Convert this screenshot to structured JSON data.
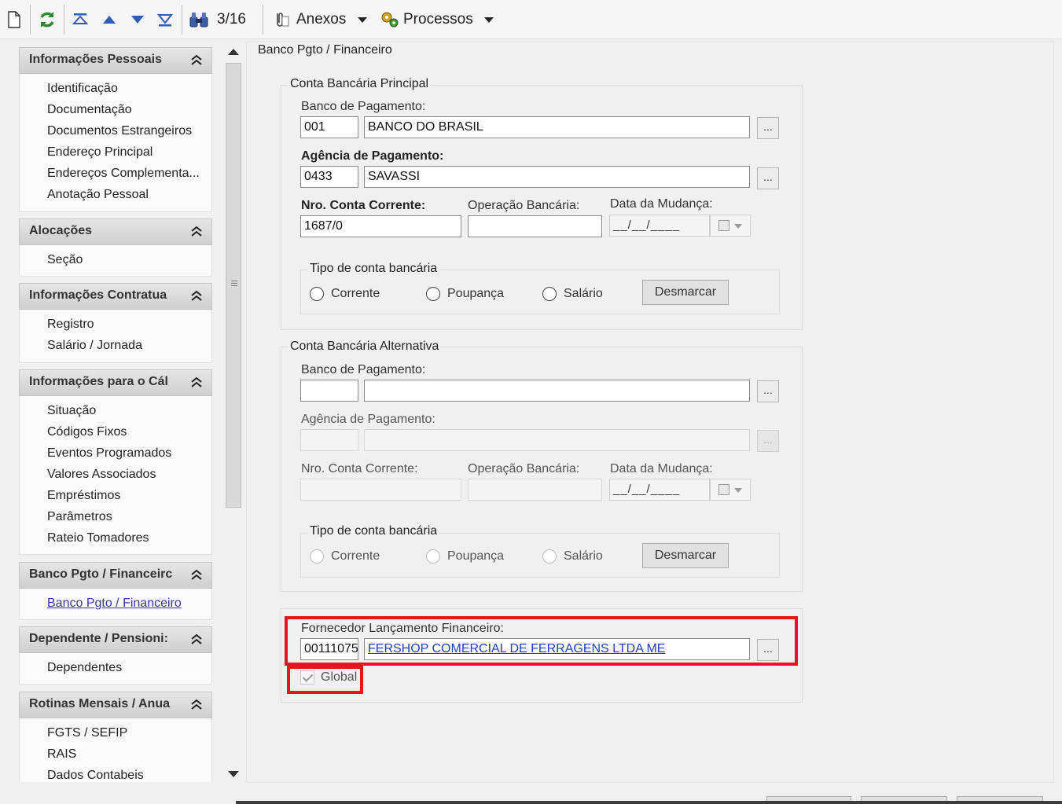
{
  "toolbar": {
    "record_counter": "3/16",
    "attachments_label": "Anexos",
    "processes_label": "Processos",
    "icons": [
      "new-document-icon",
      "refresh-icon",
      "first-record-icon",
      "previous-record-icon",
      "next-record-icon",
      "last-record-icon",
      "binoculars-search-icon",
      "paperclip-icon",
      "gears-icon"
    ]
  },
  "sidebar": {
    "sections": [
      {
        "title": "Informações Pessoais",
        "items": [
          "Identificação",
          "Documentação",
          "Documentos Estrangeiros",
          "Endereço Principal",
          "Endereços Complementa...",
          "Anotação Pessoal"
        ]
      },
      {
        "title": "Alocações",
        "items": [
          "Seção"
        ]
      },
      {
        "title": "Informações Contratua",
        "items": [
          "Registro",
          "Salário / Jornada"
        ]
      },
      {
        "title": "Informações para o Cál",
        "items": [
          "Situação",
          "Códigos Fixos",
          "Eventos Programados",
          "Valores Associados",
          "Empréstimos",
          "Parâmetros",
          "Rateio Tomadores"
        ]
      },
      {
        "title": "Banco Pgto / Financeirc",
        "items": [
          "Banco Pgto / Financeiro"
        ]
      },
      {
        "title": "Dependente / Pensioni:",
        "items": [
          "Dependentes"
        ]
      },
      {
        "title": "Rotinas Mensais / Anua",
        "items": [
          "FGTS / SEFIP",
          "RAIS",
          "Dados Contabeis"
        ]
      }
    ]
  },
  "main": {
    "title": "Banco Pgto / Financeiro",
    "principal": {
      "legend": "Conta Bancária Principal",
      "bank_label": "Banco de  Pagamento:",
      "bank_code": "001",
      "bank_name": "BANCO DO BRASIL",
      "agency_label": "Agência de Pagamento:",
      "agency_code": "0433",
      "agency_name": "SAVASSI",
      "account_label": "Nro. Conta Corrente:",
      "account_value": "1687/0",
      "operation_label": "Operação Bancária:",
      "operation_value": "",
      "date_label": "Data da Mudança:",
      "date_value": "__/__/____",
      "type_legend": "Tipo de conta bancária",
      "radio_options": [
        "Corrente",
        "Poupança",
        "Salário"
      ],
      "clear_button": "Desmarcar",
      "dots": "..."
    },
    "alternativa": {
      "legend": "Conta Bancária Alternativa",
      "bank_label": "Banco de  Pagamento:",
      "bank_code": "",
      "bank_name": "",
      "agency_label": "Agência de Pagamento:",
      "account_label": "Nro. Conta Corrente:",
      "operation_label": "Operação Bancária:",
      "date_label": "Data da Mudança:",
      "date_value": "__/__/____",
      "type_legend": "Tipo de conta bancária",
      "radio_options": [
        "Corrente",
        "Poupança",
        "Salário"
      ],
      "clear_button": "Desmarcar",
      "dots": "..."
    },
    "fornecedor": {
      "label": "Fornecedor Lançamento Financeiro:",
      "code": "00111075",
      "name": "FERSHOP COMERCIAL DE FERRAGENS LTDA ME",
      "dots": "...",
      "global_label": "Global",
      "global_checked": true
    }
  },
  "colors": {
    "highlight": "#e8141b",
    "link": "#1f3fc4",
    "header_gradient_top": "#e6e6e6",
    "header_gradient_bottom": "#cfcfcf"
  }
}
